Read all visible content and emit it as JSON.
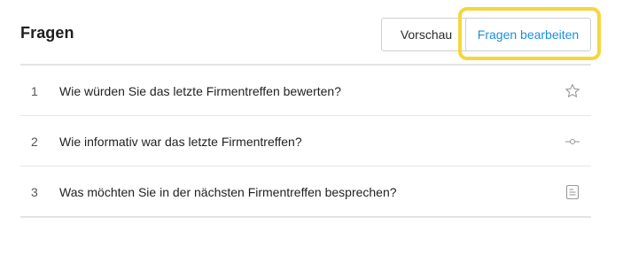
{
  "header": {
    "title": "Fragen",
    "preview_label": "Vorschau",
    "edit_label": "Fragen bearbeiten"
  },
  "questions": [
    {
      "number": "1",
      "text": "Wie würden Sie das letzte Firmentreffen bewerten?",
      "icon": "star-icon"
    },
    {
      "number": "2",
      "text": "Wie informativ war das letzte Firmentreffen?",
      "icon": "slider-scale-icon"
    },
    {
      "number": "3",
      "text": "Was möchten Sie in der nächsten Firmentreffen besprechen?",
      "icon": "text-answer-icon"
    }
  ],
  "colors": {
    "accent": "#1a8fe0",
    "highlight": "#f5d63d",
    "icon": "#9a9a9a"
  }
}
